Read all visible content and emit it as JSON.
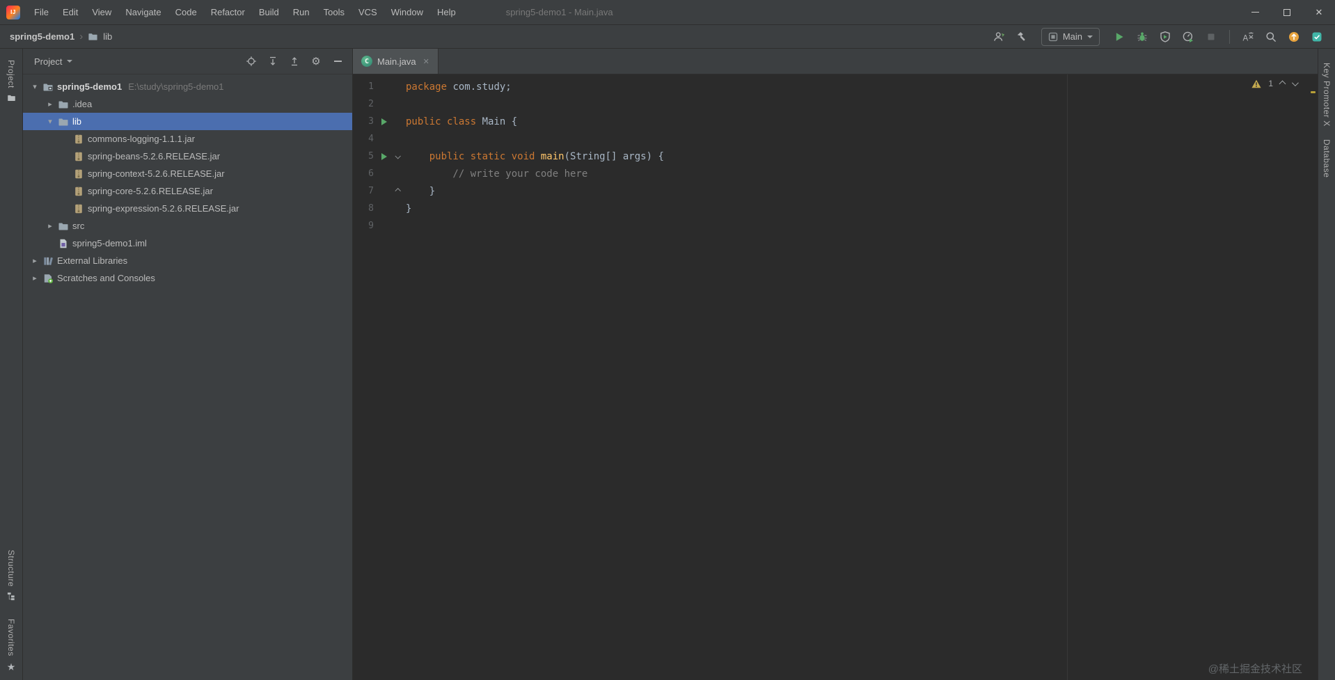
{
  "window": {
    "app_logo": "IJ",
    "title": "spring5-demo1 - Main.java",
    "menu": [
      "File",
      "Edit",
      "View",
      "Navigate",
      "Code",
      "Refactor",
      "Build",
      "Run",
      "Tools",
      "VCS",
      "Window",
      "Help"
    ]
  },
  "navbar": {
    "breadcrumb": {
      "project": "spring5-demo1",
      "folder": "lib"
    },
    "run_config": "Main",
    "actions": [
      {
        "type": "icon",
        "name": "collaborate-user"
      },
      {
        "type": "icon",
        "name": "build-hammer"
      },
      {
        "type": "combo"
      },
      {
        "type": "icon",
        "name": "run"
      },
      {
        "type": "icon",
        "name": "debug"
      },
      {
        "type": "icon",
        "name": "run-coverage"
      },
      {
        "type": "icon",
        "name": "profiler"
      },
      {
        "type": "icon",
        "name": "stop",
        "disabled": true
      },
      {
        "type": "divider"
      },
      {
        "type": "icon",
        "name": "translate"
      },
      {
        "type": "icon",
        "name": "search-everywhere"
      },
      {
        "type": "icon",
        "name": "ide-update"
      },
      {
        "type": "icon",
        "name": "plugin-extra"
      }
    ]
  },
  "left_stripe": {
    "top_tabs": [
      {
        "label": "Project",
        "icon": "project-tab"
      }
    ],
    "bottom_tabs": [
      {
        "label": "Structure",
        "icon": "structure-tab"
      },
      {
        "label": "Favorites",
        "icon": "favorites-star"
      }
    ]
  },
  "right_stripe": {
    "tabs": [
      {
        "label": "Key Promoter X"
      },
      {
        "label": "Database"
      }
    ]
  },
  "project_panel": {
    "title": "Project",
    "tree": [
      {
        "indent": 0,
        "chevron": "expanded",
        "icon": "project-folder",
        "label": "spring5-demo1",
        "path": "E:\\study\\spring5-demo1",
        "bold": true
      },
      {
        "indent": 1,
        "chevron": "collapsed",
        "icon": "folder",
        "label": ".idea"
      },
      {
        "indent": 1,
        "chevron": "expanded",
        "icon": "folder",
        "label": "lib",
        "selected": true
      },
      {
        "indent": 2,
        "chevron": "none",
        "icon": "jar",
        "label": "commons-logging-1.1.1.jar"
      },
      {
        "indent": 2,
        "chevron": "none",
        "icon": "jar",
        "label": "spring-beans-5.2.6.RELEASE.jar"
      },
      {
        "indent": 2,
        "chevron": "none",
        "icon": "jar",
        "label": "spring-context-5.2.6.RELEASE.jar"
      },
      {
        "indent": 2,
        "chevron": "none",
        "icon": "jar",
        "label": "spring-core-5.2.6.RELEASE.jar"
      },
      {
        "indent": 2,
        "chevron": "none",
        "icon": "jar",
        "label": "spring-expression-5.2.6.RELEASE.jar"
      },
      {
        "indent": 1,
        "chevron": "collapsed",
        "icon": "folder",
        "label": "src"
      },
      {
        "indent": 1,
        "chevron": "none",
        "icon": "iml-file",
        "label": "spring5-demo1.iml"
      },
      {
        "indent": 0,
        "chevron": "collapsed",
        "icon": "libraries",
        "label": "External Libraries"
      },
      {
        "indent": 0,
        "chevron": "collapsed",
        "icon": "scratches",
        "label": "Scratches and Consoles"
      }
    ]
  },
  "editor": {
    "tab": "Main.java",
    "inspection_count": "1",
    "lines": [
      {
        "num": "1",
        "segments": [
          [
            "kw",
            "package"
          ],
          [
            "pl",
            " com.study;"
          ]
        ]
      },
      {
        "num": "2",
        "segments": []
      },
      {
        "num": "3",
        "gutter": "run",
        "segments": [
          [
            "kw",
            "public class"
          ],
          [
            "pl",
            " Main {"
          ]
        ]
      },
      {
        "num": "4",
        "segments": []
      },
      {
        "num": "5",
        "gutter": "run",
        "fold": "open",
        "segments": [
          [
            "pl",
            "    "
          ],
          [
            "kw",
            "public static void"
          ],
          [
            "pl",
            " "
          ],
          [
            "fn",
            "main"
          ],
          [
            "pl",
            "(String[] args) {"
          ]
        ]
      },
      {
        "num": "6",
        "segments": [
          [
            "cm",
            "        // write your code here"
          ]
        ]
      },
      {
        "num": "7",
        "fold": "close",
        "segments": [
          [
            "pl",
            "    }"
          ]
        ]
      },
      {
        "num": "8",
        "segments": [
          [
            "pl",
            "}"
          ]
        ]
      },
      {
        "num": "9",
        "segments": []
      }
    ]
  },
  "watermark": "@稀土掘金技术社区",
  "colors": {
    "keyword": "#cc7832",
    "plain": "#a9b7c6",
    "comment": "#808080",
    "method": "#ffc66b",
    "selection": "#4b6eaf",
    "run_green": "#59a869",
    "update_orange": "#e8a33d",
    "editor_bg": "#2b2b2b",
    "panel_bg": "#3c3f41"
  }
}
